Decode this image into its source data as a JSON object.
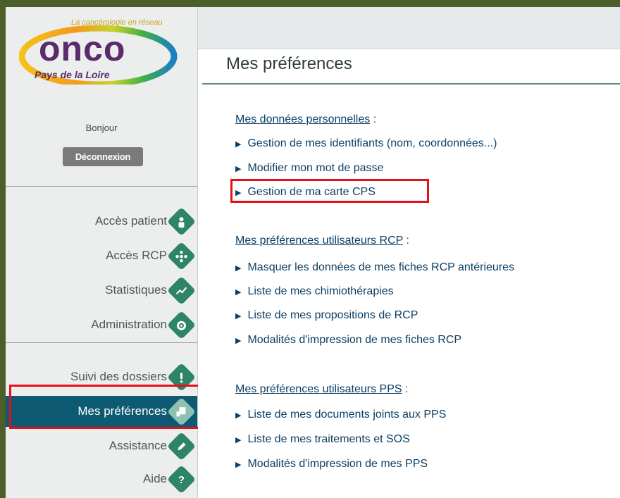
{
  "logo": {
    "tagline": "La cancérologie en réseau",
    "name": "onco",
    "region": "Pays de la Loire"
  },
  "user": {
    "greeting": "Bonjour",
    "logout_label": "Déconnexion"
  },
  "nav": {
    "group1": [
      {
        "label": "Accès patient",
        "icon": "patient-icon"
      },
      {
        "label": "Accès RCP",
        "icon": "rcp-group-icon"
      },
      {
        "label": "Statistiques",
        "icon": "chart-line-icon"
      },
      {
        "label": "Administration",
        "icon": "gear-icon"
      }
    ],
    "group2": [
      {
        "label": "Suivi des dossiers",
        "icon": "exclamation-icon"
      },
      {
        "label": "Mes préférences",
        "icon": "preferences-icon",
        "active": true
      },
      {
        "label": "Assistance",
        "icon": "pencil-icon"
      },
      {
        "label": "Aide",
        "icon": "question-icon"
      }
    ]
  },
  "page": {
    "title": "Mes préférences"
  },
  "sections": [
    {
      "heading": "Mes données personnelles",
      "links": [
        "Gestion de mes identifiants (nom, coordonnées...)",
        "Modifier mon mot de passe",
        "Gestion de ma carte CPS"
      ]
    },
    {
      "heading": "Mes préférences utilisateurs RCP",
      "links": [
        "Masquer les données de mes fiches RCP antérieures",
        "Liste de mes chimiothérapies",
        "Liste de mes propositions de RCP",
        "Modalités d'impression de mes fiches RCP"
      ]
    },
    {
      "heading": "Mes préférences utilisateurs PPS",
      "links": [
        "Liste de mes documents joints aux PPS",
        "Liste de mes traitements et SOS",
        "Modalités d'impression de mes PPS"
      ]
    }
  ],
  "colors": {
    "frame": "#4c5e2a",
    "nav_active": "#0f5a73",
    "icon_diamond": "#2e8466",
    "link": "#0d3f65",
    "highlight": "#e3101a"
  }
}
